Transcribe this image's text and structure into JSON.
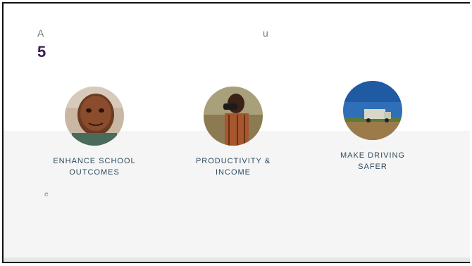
{
  "header": {
    "letter_a": "A",
    "letter_u": "u",
    "number": "5"
  },
  "cards": [
    {
      "label_line1": "ENHANCE SCHOOL",
      "label_line2": "OUTCOMES",
      "image": "child-portrait"
    },
    {
      "label_line1": "PRODUCTIVITY &",
      "label_line2": "INCOME",
      "image": "man-with-binoculars"
    },
    {
      "label_line1": "MAKE DRIVING",
      "label_line2": "SAFER",
      "image": "truck-on-road"
    }
  ],
  "note": "e",
  "colors": {
    "accent_number": "#3b1d4f",
    "label_text": "#2c4a5e",
    "band_bg": "#f5f5f5"
  }
}
